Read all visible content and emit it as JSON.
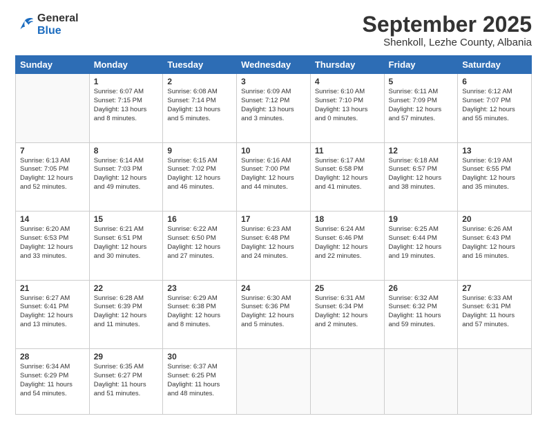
{
  "header": {
    "logo_line1": "General",
    "logo_line2": "Blue",
    "title": "September 2025",
    "subtitle": "Shenkoll, Lezhe County, Albania"
  },
  "weekdays": [
    "Sunday",
    "Monday",
    "Tuesday",
    "Wednesday",
    "Thursday",
    "Friday",
    "Saturday"
  ],
  "weeks": [
    [
      {
        "day": "",
        "info": ""
      },
      {
        "day": "1",
        "info": "Sunrise: 6:07 AM\nSunset: 7:15 PM\nDaylight: 13 hours\nand 8 minutes."
      },
      {
        "day": "2",
        "info": "Sunrise: 6:08 AM\nSunset: 7:14 PM\nDaylight: 13 hours\nand 5 minutes."
      },
      {
        "day": "3",
        "info": "Sunrise: 6:09 AM\nSunset: 7:12 PM\nDaylight: 13 hours\nand 3 minutes."
      },
      {
        "day": "4",
        "info": "Sunrise: 6:10 AM\nSunset: 7:10 PM\nDaylight: 13 hours\nand 0 minutes."
      },
      {
        "day": "5",
        "info": "Sunrise: 6:11 AM\nSunset: 7:09 PM\nDaylight: 12 hours\nand 57 minutes."
      },
      {
        "day": "6",
        "info": "Sunrise: 6:12 AM\nSunset: 7:07 PM\nDaylight: 12 hours\nand 55 minutes."
      }
    ],
    [
      {
        "day": "7",
        "info": "Sunrise: 6:13 AM\nSunset: 7:05 PM\nDaylight: 12 hours\nand 52 minutes."
      },
      {
        "day": "8",
        "info": "Sunrise: 6:14 AM\nSunset: 7:03 PM\nDaylight: 12 hours\nand 49 minutes."
      },
      {
        "day": "9",
        "info": "Sunrise: 6:15 AM\nSunset: 7:02 PM\nDaylight: 12 hours\nand 46 minutes."
      },
      {
        "day": "10",
        "info": "Sunrise: 6:16 AM\nSunset: 7:00 PM\nDaylight: 12 hours\nand 44 minutes."
      },
      {
        "day": "11",
        "info": "Sunrise: 6:17 AM\nSunset: 6:58 PM\nDaylight: 12 hours\nand 41 minutes."
      },
      {
        "day": "12",
        "info": "Sunrise: 6:18 AM\nSunset: 6:57 PM\nDaylight: 12 hours\nand 38 minutes."
      },
      {
        "day": "13",
        "info": "Sunrise: 6:19 AM\nSunset: 6:55 PM\nDaylight: 12 hours\nand 35 minutes."
      }
    ],
    [
      {
        "day": "14",
        "info": "Sunrise: 6:20 AM\nSunset: 6:53 PM\nDaylight: 12 hours\nand 33 minutes."
      },
      {
        "day": "15",
        "info": "Sunrise: 6:21 AM\nSunset: 6:51 PM\nDaylight: 12 hours\nand 30 minutes."
      },
      {
        "day": "16",
        "info": "Sunrise: 6:22 AM\nSunset: 6:50 PM\nDaylight: 12 hours\nand 27 minutes."
      },
      {
        "day": "17",
        "info": "Sunrise: 6:23 AM\nSunset: 6:48 PM\nDaylight: 12 hours\nand 24 minutes."
      },
      {
        "day": "18",
        "info": "Sunrise: 6:24 AM\nSunset: 6:46 PM\nDaylight: 12 hours\nand 22 minutes."
      },
      {
        "day": "19",
        "info": "Sunrise: 6:25 AM\nSunset: 6:44 PM\nDaylight: 12 hours\nand 19 minutes."
      },
      {
        "day": "20",
        "info": "Sunrise: 6:26 AM\nSunset: 6:43 PM\nDaylight: 12 hours\nand 16 minutes."
      }
    ],
    [
      {
        "day": "21",
        "info": "Sunrise: 6:27 AM\nSunset: 6:41 PM\nDaylight: 12 hours\nand 13 minutes."
      },
      {
        "day": "22",
        "info": "Sunrise: 6:28 AM\nSunset: 6:39 PM\nDaylight: 12 hours\nand 11 minutes."
      },
      {
        "day": "23",
        "info": "Sunrise: 6:29 AM\nSunset: 6:38 PM\nDaylight: 12 hours\nand 8 minutes."
      },
      {
        "day": "24",
        "info": "Sunrise: 6:30 AM\nSunset: 6:36 PM\nDaylight: 12 hours\nand 5 minutes."
      },
      {
        "day": "25",
        "info": "Sunrise: 6:31 AM\nSunset: 6:34 PM\nDaylight: 12 hours\nand 2 minutes."
      },
      {
        "day": "26",
        "info": "Sunrise: 6:32 AM\nSunset: 6:32 PM\nDaylight: 11 hours\nand 59 minutes."
      },
      {
        "day": "27",
        "info": "Sunrise: 6:33 AM\nSunset: 6:31 PM\nDaylight: 11 hours\nand 57 minutes."
      }
    ],
    [
      {
        "day": "28",
        "info": "Sunrise: 6:34 AM\nSunset: 6:29 PM\nDaylight: 11 hours\nand 54 minutes."
      },
      {
        "day": "29",
        "info": "Sunrise: 6:35 AM\nSunset: 6:27 PM\nDaylight: 11 hours\nand 51 minutes."
      },
      {
        "day": "30",
        "info": "Sunrise: 6:37 AM\nSunset: 6:25 PM\nDaylight: 11 hours\nand 48 minutes."
      },
      {
        "day": "",
        "info": ""
      },
      {
        "day": "",
        "info": ""
      },
      {
        "day": "",
        "info": ""
      },
      {
        "day": "",
        "info": ""
      }
    ]
  ]
}
